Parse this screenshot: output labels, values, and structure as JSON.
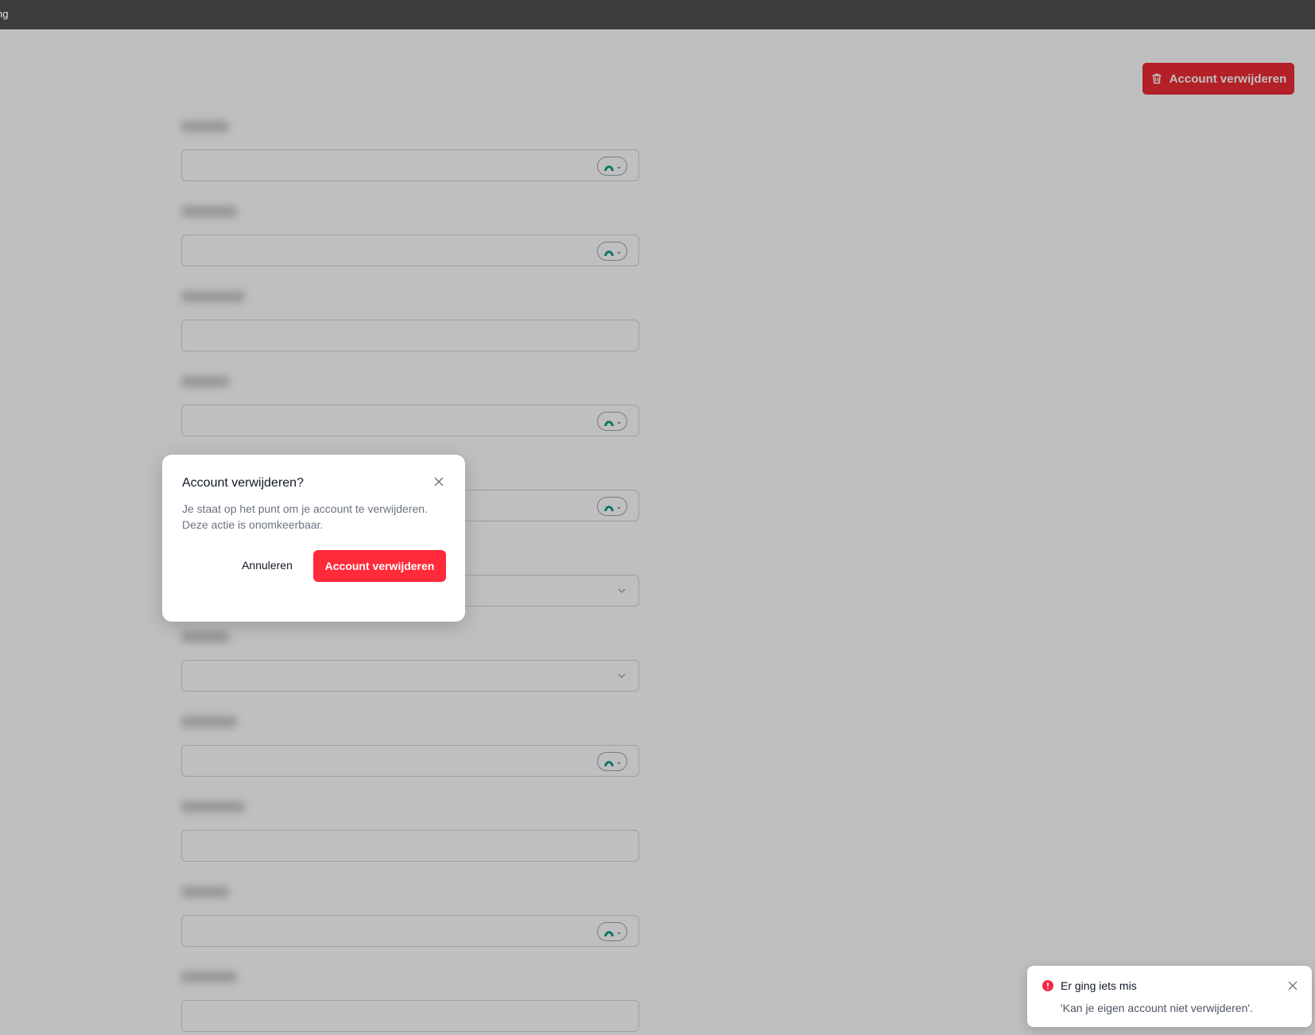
{
  "window": {
    "title_fragment": "ng"
  },
  "header": {
    "delete_button_label": "Account verwijderen"
  },
  "form": {
    "rows": [
      {
        "kind": "toggle"
      },
      {
        "kind": "toggle"
      },
      {
        "kind": "plain"
      },
      {
        "kind": "toggle"
      },
      {
        "kind": "toggle"
      },
      {
        "kind": "select"
      },
      {
        "kind": "select"
      },
      {
        "kind": "toggle"
      },
      {
        "kind": "plain"
      },
      {
        "kind": "toggle"
      },
      {
        "kind": "plain"
      }
    ]
  },
  "modal": {
    "title": "Account verwijderen?",
    "body_line1": "Je staat op het punt om je account te verwijderen.",
    "body_line2": "Deze actie is onomkeerbaar.",
    "cancel_label": "Annuleren",
    "confirm_label": "Account verwijderen"
  },
  "toast": {
    "title": "Er ging iets mis",
    "message": "'Kan je eigen account niet verwijderen'."
  },
  "colors": {
    "danger": "#ff2b3a",
    "toggle_icon": "#0f9f8a"
  },
  "icons": {
    "delete": "trash-icon",
    "close": "close-icon",
    "error": "error-circle-icon",
    "toggle": "visibility-toggle-icon",
    "select": "chevron-down-icon"
  }
}
